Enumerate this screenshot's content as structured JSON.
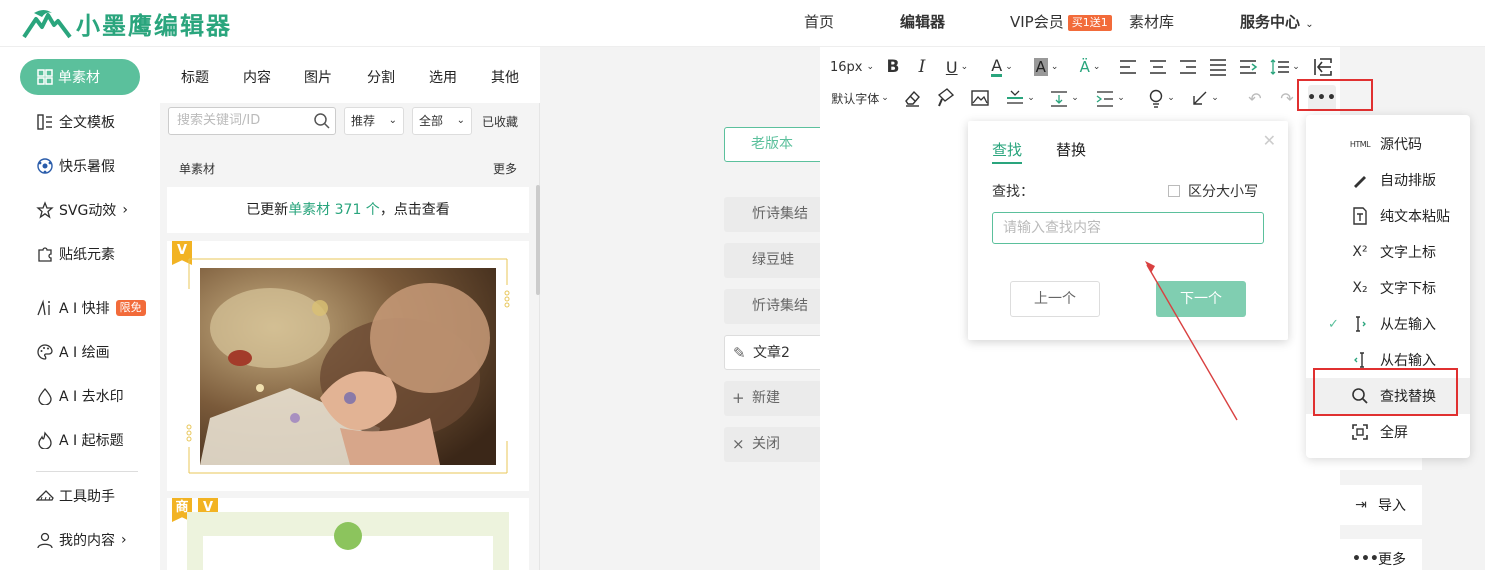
{
  "header": {
    "logo_text": "小墨鹰编辑器",
    "nav": [
      "首页",
      "编辑器",
      "VIP会员",
      "素材库",
      "服务中心"
    ],
    "vip_badge": "买1送1"
  },
  "left_nav": {
    "active": "单素材",
    "items": [
      "全文模板",
      "快乐暑假",
      "SVG动效",
      "贴纸元素",
      "A I 快排",
      "A I 绘画",
      "A I 去水印",
      "A I 起标题",
      "工具助手",
      "我的内容"
    ],
    "free_badge": "限免"
  },
  "material_panel": {
    "tabs": [
      "标题",
      "内容",
      "图片",
      "分割",
      "选用",
      "其他"
    ],
    "search_placeholder": "搜索关键词/ID",
    "sort_select": "推荐",
    "filter_select": "全部",
    "favorites": "已收藏",
    "section_title": "单素材",
    "section_more": "更多",
    "update_prefix": "已更新",
    "update_link": "单素材 371 个",
    "update_suffix": "，点击查看",
    "badge_shang": "商",
    "badge_v": "V"
  },
  "middle": {
    "old_version": "老版本",
    "articles": [
      "忻诗集结",
      "绿豆蛙",
      "忻诗集结"
    ],
    "current_article": "文章2",
    "new": "新建",
    "close": "关闭"
  },
  "toolbar": {
    "font_size": "16px",
    "font_family": "默认字体"
  },
  "find_dialog": {
    "tab_find": "查找",
    "tab_replace": "替换",
    "label": "查找：",
    "case_sensitive": "区分大小写",
    "input_placeholder": "请输入查找内容",
    "prev": "上一个",
    "next": "下一个",
    "close_glyph": "✕"
  },
  "more_menu": {
    "items": [
      "源代码",
      "自动排版",
      "纯文本粘贴",
      "文字上标",
      "文字下标",
      "从左输入",
      "从右输入",
      "查找替换",
      "全屏"
    ],
    "html_icon_text": "HTML",
    "sup_icon": "X²",
    "sub_icon": "X₂"
  },
  "side_buttons": {
    "import": "导入",
    "more": "更多"
  },
  "colors": {
    "brand": "#2aa57d",
    "accent": "#5bc09c",
    "badge": "#f26b3a",
    "annotation": "#e03030"
  }
}
